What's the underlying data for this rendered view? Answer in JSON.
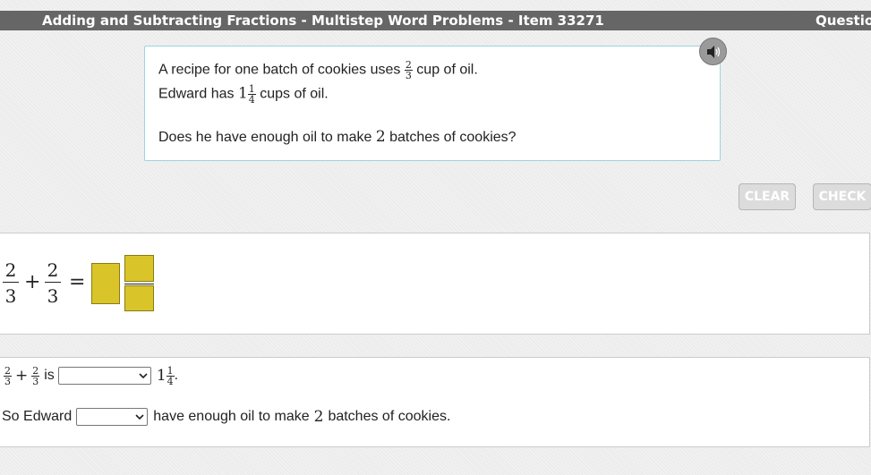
{
  "header": {
    "title": "Adding and Subtracting Fractions - Multistep Word Problems - Item 33271",
    "question_label": "Question"
  },
  "problem": {
    "line1_prefix": "A recipe for one batch of cookies uses",
    "line1_frac": {
      "num": "2",
      "den": "3"
    },
    "line1_suffix": "cup of oil.",
    "line2_prefix": "Edward has",
    "line2_whole": "1",
    "line2_frac": {
      "num": "1",
      "den": "4"
    },
    "line2_suffix": "cups of oil.",
    "line3_prefix": "Does he have enough oil to make",
    "line3_number": "2",
    "line3_suffix": "batches of cookies?"
  },
  "toolbar": {
    "clear_label": "CLEAR",
    "check_label": "CHECK"
  },
  "equation": {
    "frac1": {
      "num": "2",
      "den": "3"
    },
    "plus": "+",
    "frac2": {
      "num": "2",
      "den": "3"
    },
    "equals": "="
  },
  "comparison": {
    "frac1": {
      "num": "2",
      "den": "3"
    },
    "plus": "+",
    "frac2": {
      "num": "2",
      "den": "3"
    },
    "is_text": "is",
    "compare_select_value": "",
    "mixed_whole": "1",
    "mixed_frac": {
      "num": "1",
      "den": "4"
    },
    "period": "."
  },
  "conclusion": {
    "prefix": "So Edward",
    "select_value": "",
    "middle": "have enough oil to make",
    "number": "2",
    "suffix": "batches of cookies."
  },
  "colors": {
    "answer_box": "#d9c52a",
    "title_bar": "#666666",
    "panel_border": "#9fd3df"
  },
  "icons": {
    "audio": "speaker-icon",
    "dropdown": "chevron-down-icon"
  }
}
